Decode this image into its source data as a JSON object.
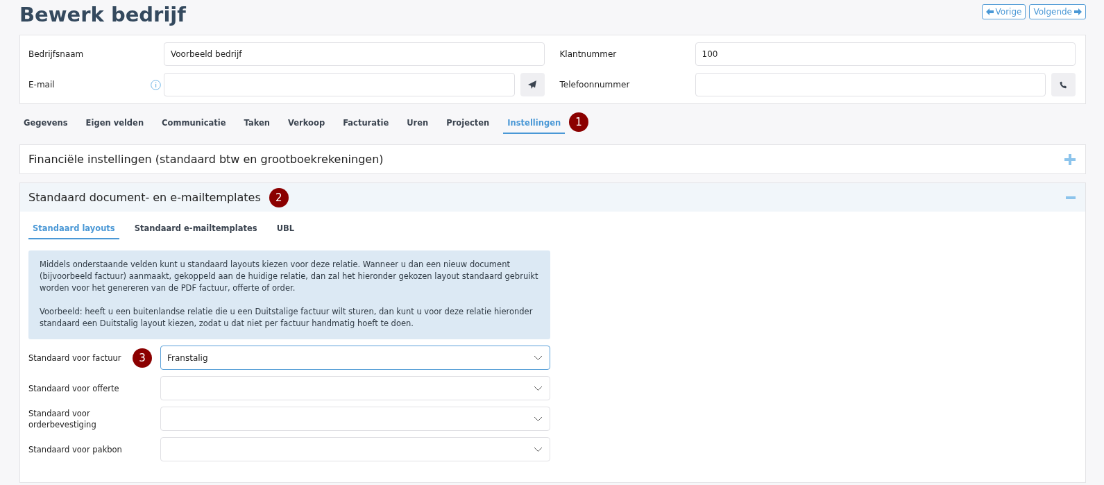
{
  "title": "Bewerk bedrijf",
  "nav_buttons": [
    {
      "label": "Vorige",
      "kind": "prev"
    },
    {
      "label": "Volgende",
      "kind": "next"
    }
  ],
  "header_fields": [
    {
      "label": "Bedrijfsnaam",
      "value": "Voorbeeld bedrijf",
      "info": false,
      "kind": "text"
    },
    {
      "label": "Klantnummer",
      "value": "100",
      "info": false,
      "kind": "text"
    },
    {
      "label": "E-mail",
      "info": true,
      "kind": "email"
    },
    {
      "label": "Telefoonnummer",
      "info": false,
      "kind": "phone"
    }
  ],
  "tabs": [
    {
      "label": "Gegevens",
      "selected": false
    },
    {
      "label": "Eigen velden",
      "selected": false
    },
    {
      "label": "Communicatie",
      "selected": false
    },
    {
      "label": "Taken",
      "selected": false
    },
    {
      "label": "Verkoop",
      "selected": false
    },
    {
      "label": "Facturatie",
      "selected": false
    },
    {
      "label": "Uren",
      "selected": false
    },
    {
      "label": "Projecten",
      "selected": false
    },
    {
      "label": "Instellingen",
      "selected": true,
      "callout": "1"
    }
  ],
  "sections": [
    {
      "title": "Financiële instellingen (standaard btw en grootboekrekeningen)",
      "expanded": false
    },
    {
      "title": "Standaard document- en e-mailtemplates",
      "expanded": true,
      "callout": "2",
      "subtabs": [
        {
          "label": "Standaard layouts",
          "selected": true
        },
        {
          "label": "Standaard e-mailtemplates",
          "selected": false
        },
        {
          "label": "UBL",
          "selected": false
        }
      ],
      "info_paragraphs": [
        "Middels onderstaande velden kunt u standaard layouts kiezen voor deze relatie. Wanneer u dan een nieuw document (bijvoorbeeld factuur) aanmaakt, gekoppeld aan de huidige relatie, dan zal het hieronder gekozen layout standaard gebruikt worden voor het genereren van de PDF factuur, offerte of order.",
        "Voorbeeld: heeft u een buitenlandse relatie die u een Duitstalige factuur wilt sturen, dan kunt u voor deze relatie hieronder standaard een Duitstalig layout kiezen, zodat u dat niet per factuur handmatig hoeft te doen."
      ],
      "selects": [
        {
          "label": "Standaard voor factuur",
          "value": "Franstalig",
          "focused": true,
          "callout": "3"
        },
        {
          "label": "Standaard voor offerte",
          "focused": false
        },
        {
          "label": "Standaard voor orderbevestiging",
          "focused": false
        },
        {
          "label": "Standaard voor pakbon",
          "focused": false
        }
      ]
    }
  ]
}
